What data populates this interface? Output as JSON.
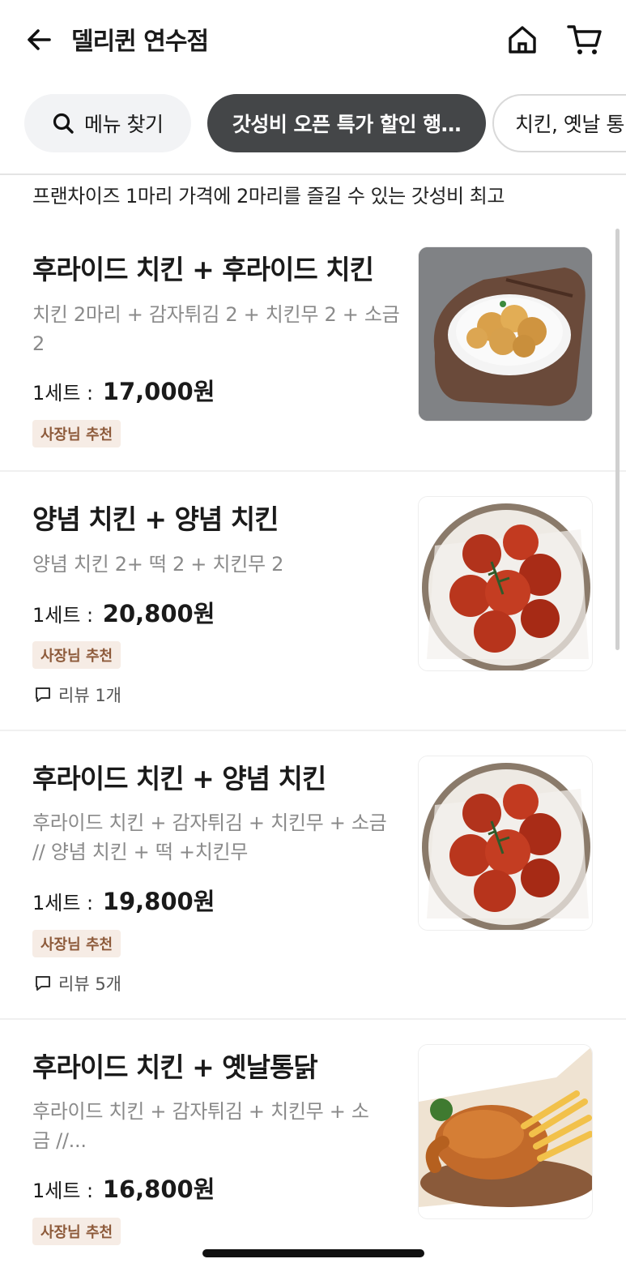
{
  "header": {
    "title": "델리퀸 연수점",
    "icons": [
      "back-arrow-icon",
      "home-icon",
      "cart-icon"
    ]
  },
  "chips": {
    "search_label": "메뉴 찾기",
    "active_label": "갓성비 오픈 특가 할인 행…",
    "next_label": "치킨, 옛날 통닭"
  },
  "section": {
    "description": "프랜차이즈 1마리 가격에 2마리를 즐길 수 있는 갓성비 최고"
  },
  "items": [
    {
      "name": "후라이드 치킨 + 후라이드 치킨",
      "desc": "치킨 2마리 + 감자튀김 2 + 치킨무 2 + 소금 2",
      "price_prefix": "1세트 :",
      "price": "17,000원",
      "badge": "사장님 추천"
    },
    {
      "name": "양념 치킨 + 양념 치킨",
      "desc": "양념 치킨 2+ 떡 2 + 치킨무 2",
      "price_prefix": "1세트 :",
      "price": "20,800원",
      "badge": "사장님 추천",
      "review": "리뷰 1개"
    },
    {
      "name": "후라이드 치킨 + 양념 치킨",
      "desc": "후라이드 치킨 + 감자튀김 + 치킨무 + 소금 // 양념 치킨 + 떡 +치킨무",
      "price_prefix": "1세트 :",
      "price": "19,800원",
      "badge": "사장님 추천",
      "review": "리뷰 5개"
    },
    {
      "name": "후라이드 치킨 + 옛날통닭",
      "desc": "후라이드 치킨 + 감자튀김 + 치킨무 + 소금 //...",
      "price_prefix": "1세트 :",
      "price": "16,800원",
      "badge": "사장님 추천"
    }
  ],
  "colors": {
    "active_chip_bg": "#444648",
    "badge_bg": "#f6ece5",
    "badge_text": "#8d5a3a",
    "desc_text": "#8a8a8a"
  }
}
